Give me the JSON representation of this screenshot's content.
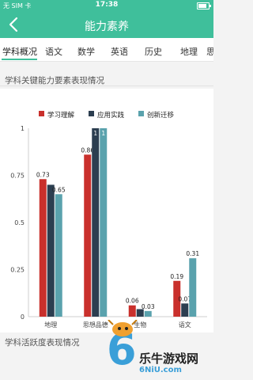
{
  "status_bar": {
    "carrier": "无 SIM 卡",
    "time": "17:38",
    "battery_level": 0.85
  },
  "nav": {
    "title": "能力素养"
  },
  "tabs": [
    {
      "label": "学科概况",
      "active": true
    },
    {
      "label": "语文"
    },
    {
      "label": "数学"
    },
    {
      "label": "英语"
    },
    {
      "label": "历史"
    },
    {
      "label": "地理"
    },
    {
      "label": "思"
    }
  ],
  "section1_title": "学科关键能力要素表现情况",
  "section2_title": "学科活跃度表现情况",
  "chart_data": {
    "type": "bar",
    "categories": [
      "地理",
      "思想品德",
      "生物",
      "语文"
    ],
    "series": [
      {
        "name": "学习理解",
        "color": "#c9302c",
        "values": [
          0.73,
          0.86,
          0.06,
          0.19
        ],
        "labels": [
          "0.73",
          "0.86",
          "0.06",
          "0.19"
        ]
      },
      {
        "name": "应用实践",
        "color": "#2c3e50",
        "values": [
          0.7,
          1.0,
          0.04,
          0.07
        ],
        "labels": [
          "",
          "1",
          "",
          "0.07"
        ]
      },
      {
        "name": "创新迁移",
        "color": "#5aa2ad",
        "values": [
          0.65,
          1.0,
          0.03,
          0.31
        ],
        "labels": [
          "0.65",
          "1",
          "0.03",
          "0.31"
        ]
      }
    ],
    "y_ticks": [
      "0",
      "0.25",
      "0.5",
      "0.75",
      "1"
    ],
    "ylim": [
      0,
      1
    ],
    "grid": false,
    "legend": "top"
  },
  "watermark": {
    "text": "乐牛游戏网",
    "url": "6NiU.com"
  },
  "colors": {
    "accent": "#3fbf9b"
  }
}
